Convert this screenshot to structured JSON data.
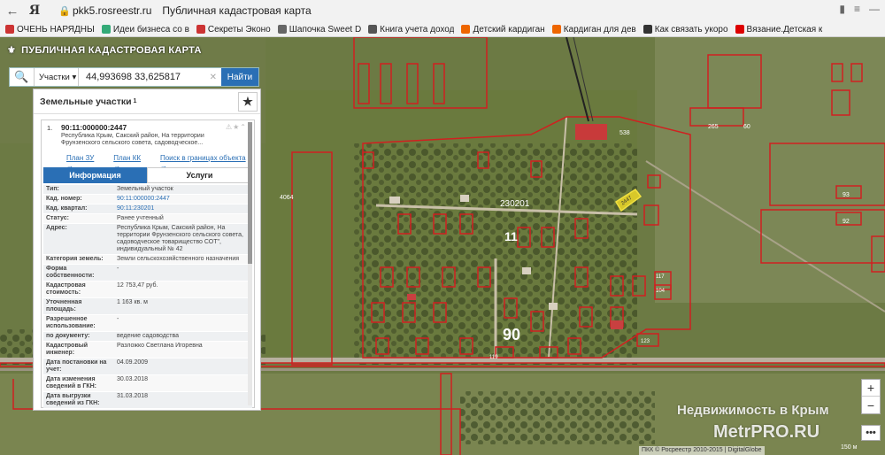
{
  "browser": {
    "host": "pkk5.rosreestr.ru",
    "page_title": "Публичная кадастровая карта",
    "logo": "Я",
    "bookmarks": [
      {
        "label": "ОЧЕНЬ НАРЯДНЫ",
        "color": "#c33"
      },
      {
        "label": "Идеи бизнеса со в",
        "color": "#3a7"
      },
      {
        "label": "Секреты Эконо",
        "color": "#c33"
      },
      {
        "label": "Шапочка Sweet D",
        "color": "#666"
      },
      {
        "label": "Книга учета доход",
        "color": "#555"
      },
      {
        "label": "Детский кардиган",
        "color": "#e60"
      },
      {
        "label": "Кардиган для дев",
        "color": "#e60"
      },
      {
        "label": "Как связать укоро",
        "color": "#333"
      },
      {
        "label": "Вязание.Детская к",
        "color": "#d00"
      }
    ]
  },
  "app": {
    "title": "ПУБЛИЧНАЯ КАДАСТРОВАЯ КАРТА"
  },
  "search": {
    "type_label": "Участки",
    "query": "44,993698 33,625817",
    "button": "Найти"
  },
  "panel": {
    "header": "Земельные участки",
    "count": "1",
    "object": {
      "index": "1.",
      "code": "90:11:000000:2447",
      "address_short": "Республика Крым, Сакский район, На территории Фрунзенского сельского совета, садоводческое...",
      "links": [
        "План ЗУ →",
        "План КК →",
        "Поиск в границах объекта →"
      ]
    },
    "tabs": [
      "Информация",
      "Услуги"
    ],
    "fields": [
      {
        "k": "Тип:",
        "v": "Земельный участок",
        "link": false
      },
      {
        "k": "Кад. номер:",
        "v": "90:11:000000:2447",
        "link": true
      },
      {
        "k": "Кад. квартал:",
        "v": "90:11:230201",
        "link": true
      },
      {
        "k": "Статус:",
        "v": "Ранее учтенный",
        "link": false
      },
      {
        "k": "Адрес:",
        "v": "Республика Крым, Сакский район, На территории Фрунзенского сельского совета, садоводческое товарищество СОТ\", индивидуальный № 42",
        "link": false
      },
      {
        "k": "Категория земель:",
        "v": "Земли сельскохозяйственного назначения",
        "link": false
      },
      {
        "k": "Форма собственности:",
        "v": "-",
        "link": false
      },
      {
        "k": "Кадастровая стоимость:",
        "v": "12 753,47 руб.",
        "link": false
      },
      {
        "k": "Уточненная площадь:",
        "v": "1 163 кв. м",
        "link": false
      },
      {
        "k": "Разрешенное использование:",
        "v": "-",
        "link": false
      },
      {
        "k": "по документу:",
        "v": "ведение садоводства",
        "link": false
      },
      {
        "k": "Кадастровый инженер:",
        "v": "Разложко Светлана Игоревна",
        "link": false
      },
      {
        "k": "Дата постановки на учет:",
        "v": "04.09.2009",
        "link": false
      },
      {
        "k": "Дата изменения сведений в ГКН:",
        "v": "30.03.2018",
        "link": false
      },
      {
        "k": "Дата выгрузки сведений из ГКН:",
        "v": "31.03.2018",
        "link": false
      }
    ]
  },
  "map": {
    "labels": [
      {
        "t": "230201"
      },
      {
        "t": "11"
      },
      {
        "t": "90"
      },
      {
        "t": "2447"
      },
      {
        "t": "538"
      },
      {
        "t": "265"
      },
      {
        "t": "60"
      },
      {
        "t": "93"
      },
      {
        "t": "92"
      },
      {
        "t": "4064"
      },
      {
        "t": "117"
      },
      {
        "t": "104"
      },
      {
        "t": "123"
      },
      {
        "t": "119"
      }
    ],
    "watermark1": "Недвижимость в Крым",
    "watermark2": "MetrPRO.RU",
    "attribution": "ПКК © Росреестр 2010-2015 | DigitalGlobe",
    "scale": "150 м"
  }
}
